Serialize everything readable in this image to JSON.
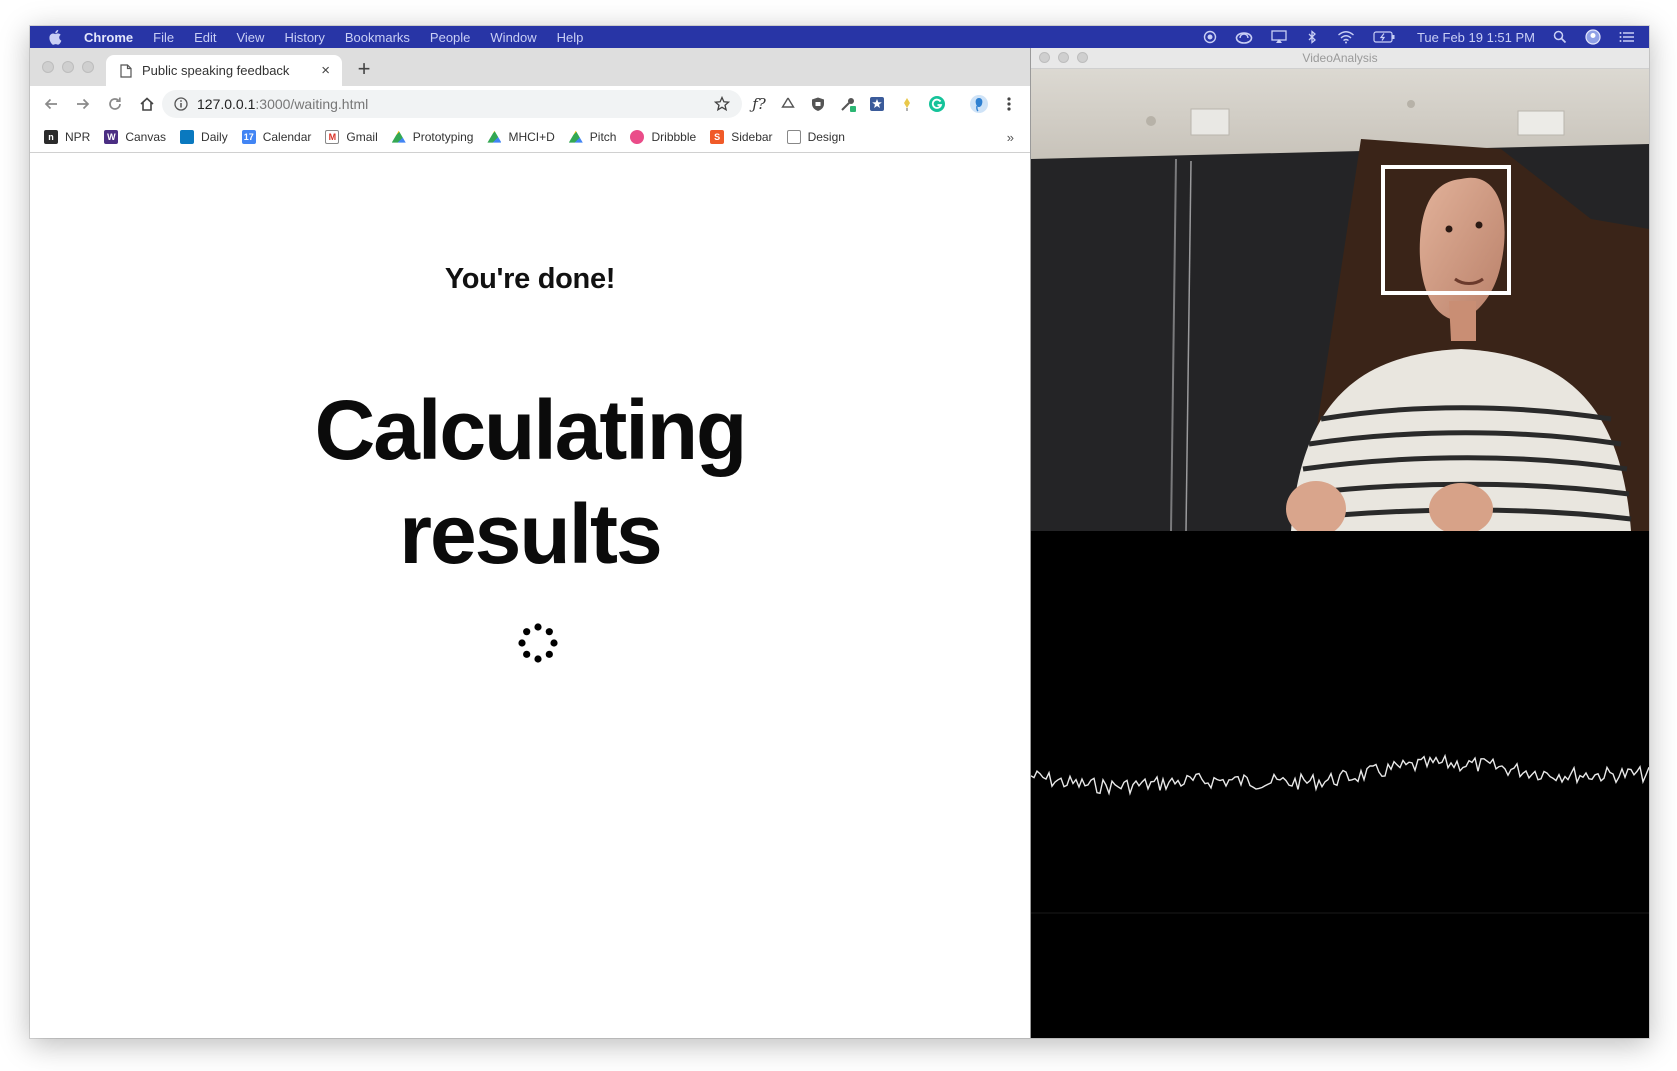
{
  "menubar": {
    "app": "Chrome",
    "items": [
      "File",
      "Edit",
      "View",
      "History",
      "Bookmarks",
      "People",
      "Window",
      "Help"
    ],
    "clock": "Tue Feb 19  1:51 PM"
  },
  "browser": {
    "tab_title": "Public speaking feedback",
    "tab_close": "×",
    "new_tab": "+",
    "url_host": "127.0.0.1",
    "url_path": ":3000/waiting.html",
    "bookmarks": [
      {
        "label": "NPR",
        "color": "#2b2b2b",
        "glyph": "n"
      },
      {
        "label": "Canvas",
        "color": "#4b2e83",
        "glyph": "W"
      },
      {
        "label": "Daily",
        "color": "#0a79bf",
        "glyph": ""
      },
      {
        "label": "Calendar",
        "color": "#4285f4",
        "glyph": "17"
      },
      {
        "label": "Gmail",
        "color": "#ffffff",
        "glyph": "M"
      },
      {
        "label": "Prototyping",
        "color": "#34a853",
        "glyph": ""
      },
      {
        "label": "MHCI+D",
        "color": "#34a853",
        "glyph": ""
      },
      {
        "label": "Pitch",
        "color": "#34a853",
        "glyph": ""
      },
      {
        "label": "Dribbble",
        "color": "#ea4c89",
        "glyph": ""
      },
      {
        "label": "Sidebar",
        "color": "#f05a28",
        "glyph": "S"
      },
      {
        "label": "Design",
        "color": "#ffffff",
        "glyph": ""
      }
    ],
    "bookmarks_more": "»"
  },
  "page": {
    "heading": "You're done!",
    "title_line1": "Calculating",
    "title_line2": "results"
  },
  "video_window": {
    "title": "VideoAnalysis"
  },
  "colors": {
    "menubar": "#2835a6",
    "face_box": "#ffffff",
    "waveform": "#e8e8e8"
  }
}
